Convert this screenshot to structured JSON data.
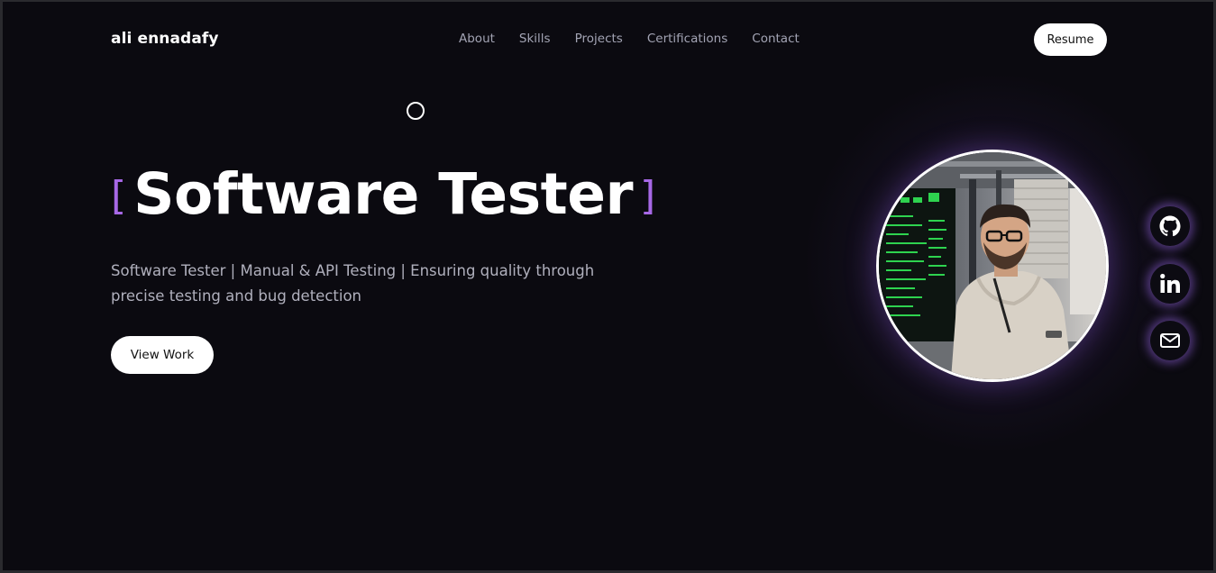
{
  "header": {
    "brand": "ali ennadafy",
    "nav": [
      "About",
      "Skills",
      "Projects",
      "Certifications",
      "Contact"
    ],
    "resume_label": "Resume"
  },
  "hero": {
    "bracket_open": "[",
    "title": "Software Tester",
    "bracket_close": "]",
    "subtitle": "Software Tester | Manual & API Testing | Ensuring quality through precise testing and bug detection",
    "cta_label": "View Work"
  },
  "social": [
    "github-icon",
    "linkedin-icon",
    "mail-icon"
  ],
  "colors": {
    "background": "#0b0a10",
    "accent": "#a768e6",
    "nav_text": "#a3a4b4",
    "body_text": "#b0b0bd"
  }
}
